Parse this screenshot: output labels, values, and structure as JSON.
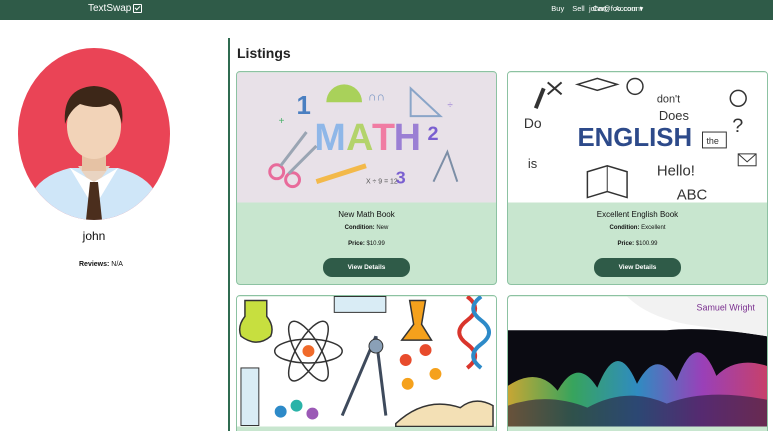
{
  "nav": {
    "brand": "TextSwap",
    "links": {
      "buy": "Buy",
      "sell": "Sell",
      "cart": "Cart",
      "account": "Account"
    },
    "user": "john@foo.com ▾"
  },
  "profile": {
    "name": "john",
    "reviews_label": "Reviews:",
    "reviews_value": " N/A"
  },
  "listings": {
    "title": "Listings",
    "cards": [
      {
        "title": "New Math Book",
        "condition_label": "Condition:",
        "condition": " New",
        "price_label": "Price:",
        "price": " $10.99",
        "button": "View Details"
      },
      {
        "title": "Excellent English Book",
        "condition_label": "Condition:",
        "condition": " Excellent",
        "price_label": "Price:",
        "price": " $100.99",
        "button": "View Details"
      },
      {
        "title": "",
        "image": "science illustration"
      },
      {
        "title": "",
        "image_text": "Samuel Wright"
      }
    ]
  },
  "colors": {
    "nav": "#2f5b48",
    "card_body": "#c8e6cf",
    "card_border": "#8cc2a2",
    "avatar_bg": "#ea4456"
  }
}
